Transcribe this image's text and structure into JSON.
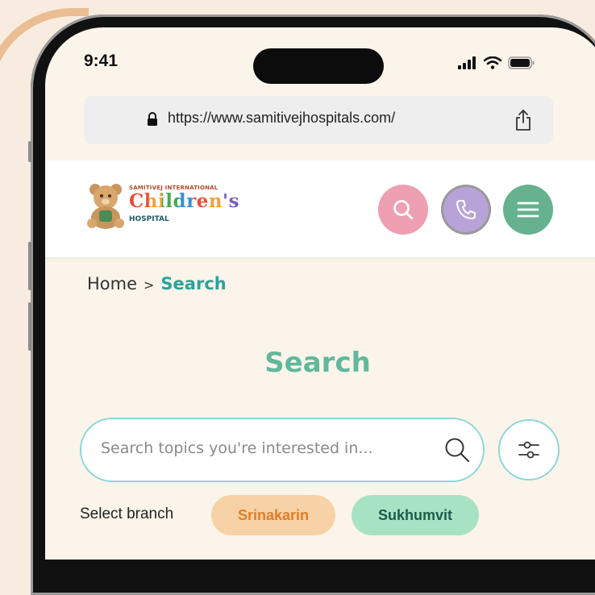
{
  "status_bar": {
    "time": "9:41"
  },
  "browser": {
    "url": "https://www.samitivejhospitals.com/"
  },
  "logo": {
    "top_text": "SAMITIVEJ INTERNATIONAL",
    "main_text": "Children's",
    "sub_text": "HOSPITAL"
  },
  "header_buttons": {
    "search_icon": "search-icon",
    "phone_icon": "phone-icon",
    "menu_icon": "hamburger-menu-icon"
  },
  "breadcrumb": {
    "home": "Home",
    "separator": ">",
    "current": "Search"
  },
  "page": {
    "title": "Search"
  },
  "search": {
    "placeholder": "Search topics you're interested in..."
  },
  "branch": {
    "label": "Select branch",
    "options": [
      "Srinakarin",
      "Sukhumvit"
    ]
  },
  "colors": {
    "background": "#f7ecdf",
    "accent_teal": "#2aa39b",
    "title_green": "#61b89c",
    "search_pink": "#ee9fb1",
    "phone_purple": "#b8a3d8",
    "menu_green": "#66b18e",
    "chip_orange": "#f7d2a6",
    "chip_green": "#a8e2c4"
  }
}
